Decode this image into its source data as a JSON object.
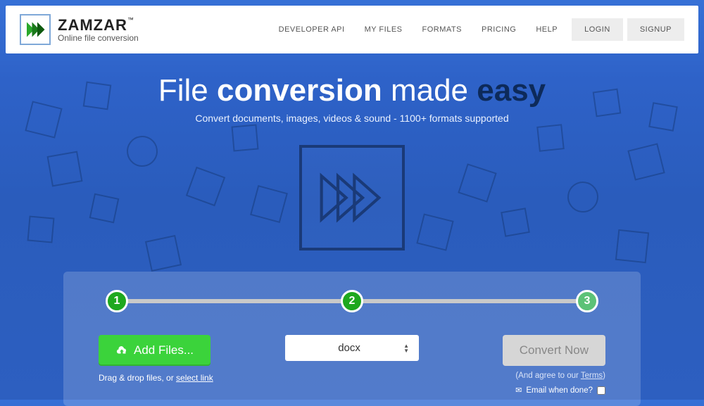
{
  "brand": {
    "name": "ZAMZAR",
    "tm": "™",
    "tagline": "Online file conversion"
  },
  "nav": {
    "developer": "DEVELOPER API",
    "myfiles": "MY FILES",
    "formats": "FORMATS",
    "pricing": "PRICING",
    "help": "HELP",
    "login": "LOGIN",
    "signup": "SIGNUP"
  },
  "hero": {
    "t1": "File ",
    "t2": "conversion",
    "t3": " made ",
    "t4": "easy",
    "sub": "Convert documents, images, videos & sound - 1100+ formats supported"
  },
  "steps": {
    "s1": "1",
    "s2": "2",
    "s3": "3"
  },
  "controls": {
    "add": "Add Files...",
    "hint_a": "Drag & drop files, or ",
    "hint_link": "select link",
    "format": "docx",
    "convert": "Convert Now",
    "terms_a": "(And agree to our ",
    "terms_link": "Terms",
    "terms_b": ")",
    "email_label": "Email when done?"
  }
}
